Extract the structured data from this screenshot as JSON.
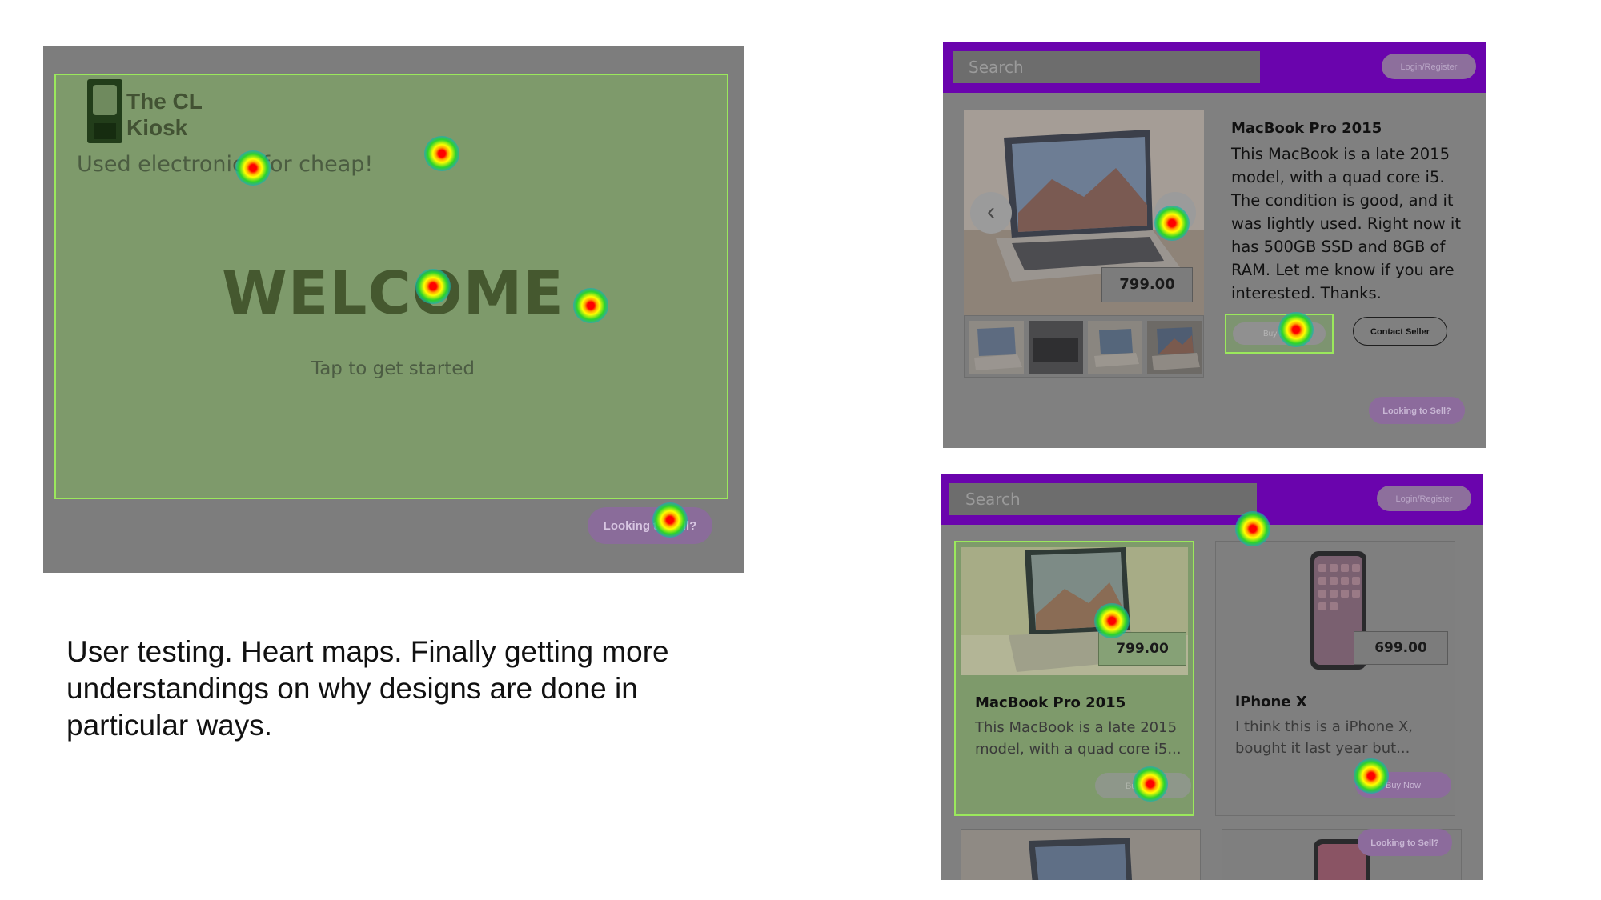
{
  "colors": {
    "accent_purple": "#6a04ad",
    "focus_green": "#9be85c",
    "overlay_gray": "#808080",
    "highlight_area_green": "#7e9a6b"
  },
  "welcome_screen": {
    "logo_title": "The CL Kiosk",
    "logo_icon": "phone-icon",
    "tagline": "Used electronics for cheap!",
    "heading": "WELCOME",
    "subtext": "Tap to get started",
    "sell_button": "Looking to Sell?"
  },
  "caption": "User testing. Heart maps. Finally getting more understandings on why designs are done in particular ways.",
  "product_detail": {
    "search_placeholder": "Search",
    "login_button": "Login/Register",
    "price": "799.00",
    "prev_icon": "chevron-left-icon",
    "next_icon": "chevron-right-icon",
    "prev_glyph": "‹",
    "next_glyph": "›",
    "title": "MacBook Pro 2015",
    "description": "This MacBook is a late 2015 model, with a quad core i5. The condition is good, and it was lightly used. Right now it has 500GB SSD and 8GB of RAM. Let me know if you are interested. Thanks.",
    "buy_button": "Buy Now",
    "contact_button": "Contact Seller",
    "sell_button": "Looking to Sell?"
  },
  "listing": {
    "search_placeholder": "Search",
    "login_button": "Login/Register",
    "sell_button": "Looking to Sell?",
    "cards": [
      {
        "title": "MacBook Pro 2015",
        "price": "799.00",
        "description": "This MacBook is a late 2015 model, with a quad core i5...",
        "buy_button": "Buy Now"
      },
      {
        "title": "iPhone X",
        "price": "699.00",
        "description": "I think this is a iPhone X, bought it last year but...",
        "buy_button": "Buy Now"
      }
    ]
  }
}
